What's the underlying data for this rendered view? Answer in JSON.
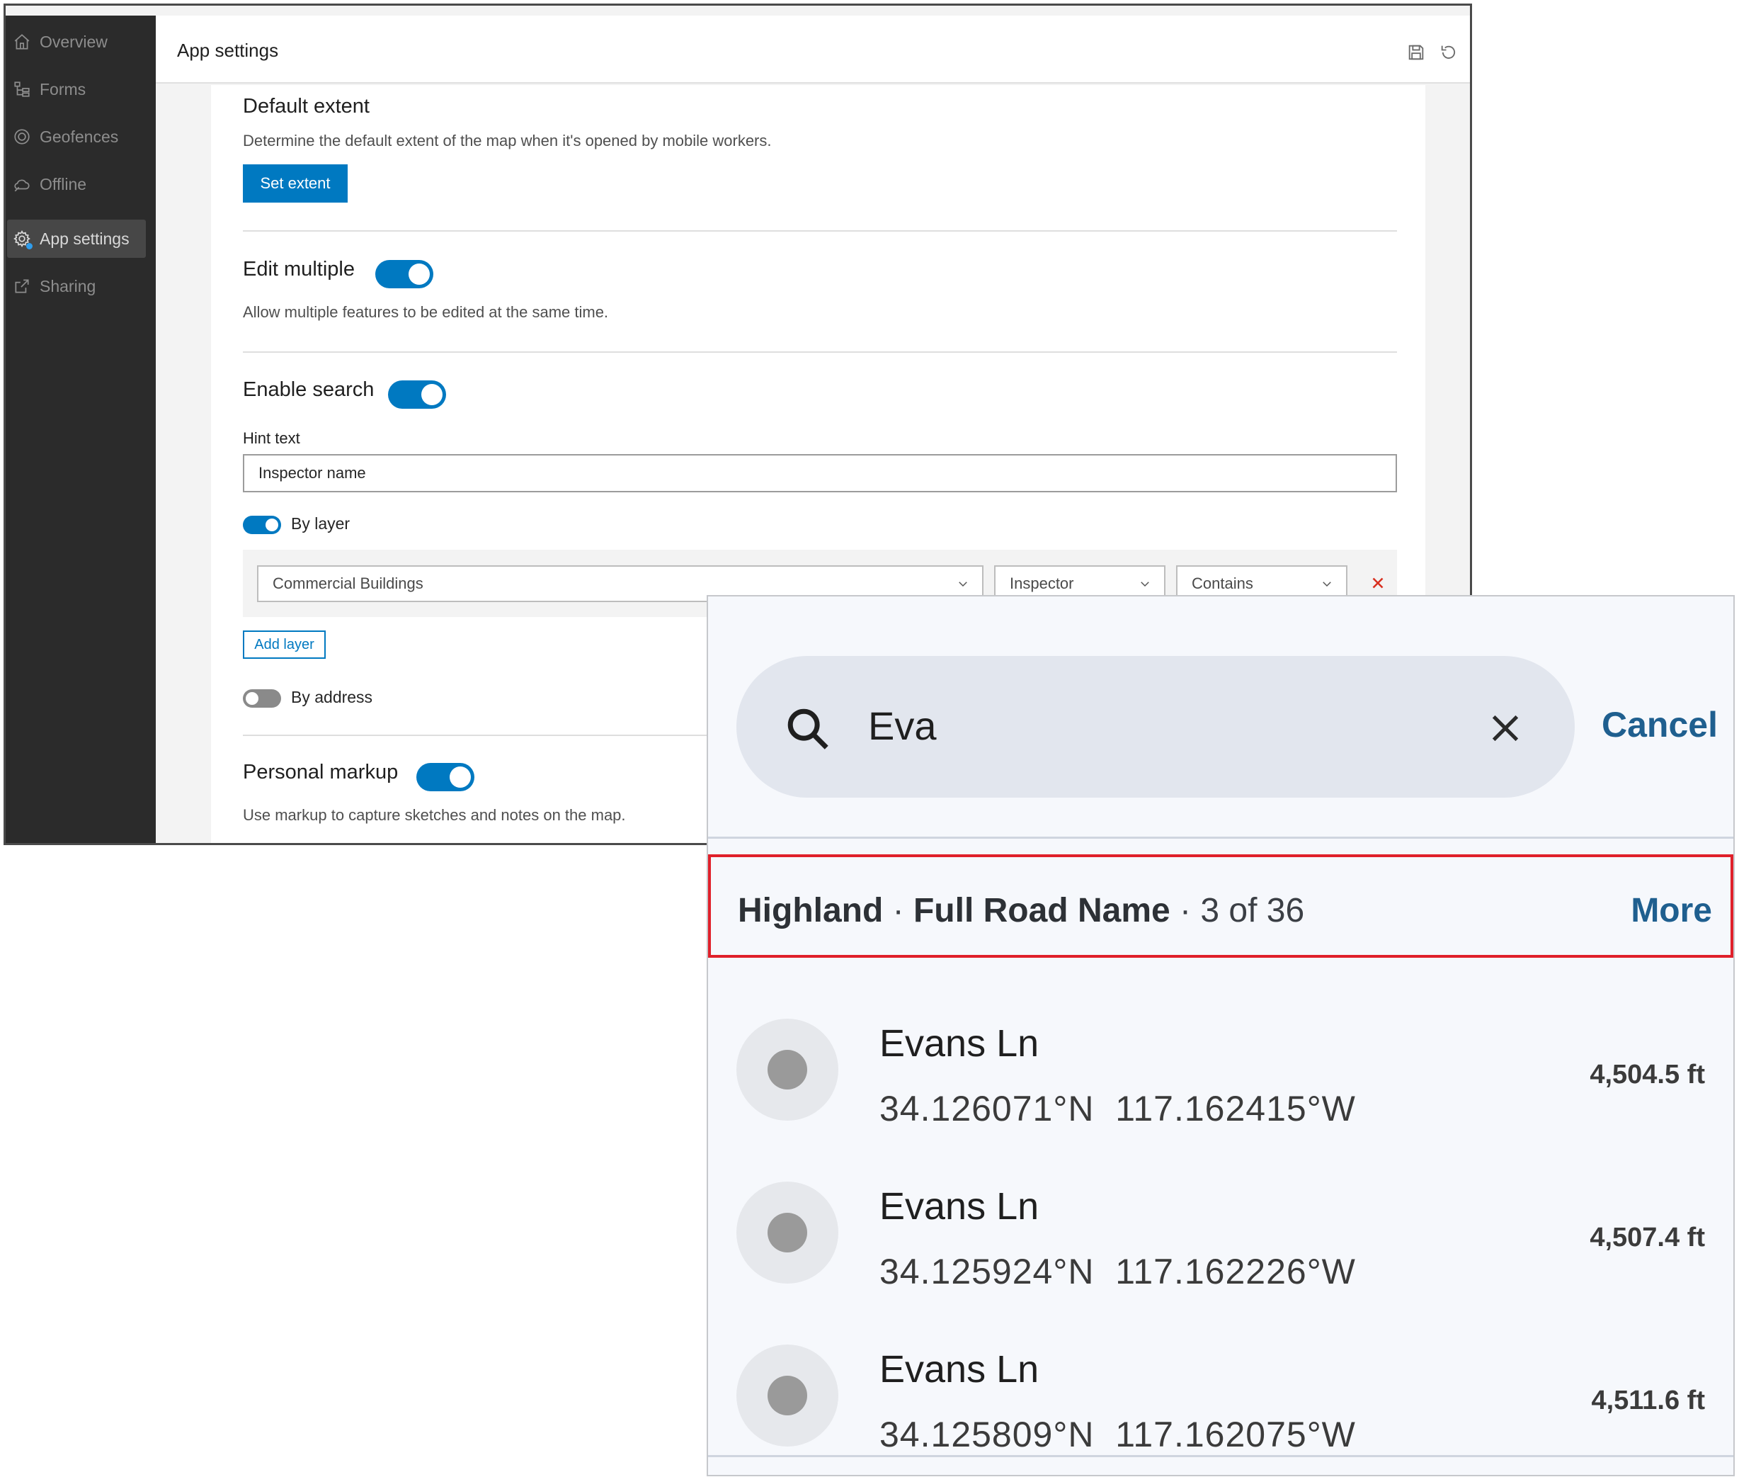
{
  "sidebar": {
    "items": [
      {
        "label": "Overview",
        "icon": "home-icon"
      },
      {
        "label": "Forms",
        "icon": "forms-tree-icon"
      },
      {
        "label": "Geofences",
        "icon": "geofence-target-icon"
      },
      {
        "label": "Offline",
        "icon": "offline-cloud-icon"
      },
      {
        "label": "App settings",
        "icon": "gear-icon",
        "active": true
      },
      {
        "label": "Sharing",
        "icon": "share-icon"
      }
    ]
  },
  "header": {
    "title": "App settings",
    "icons": [
      "save-icon",
      "reset-icon"
    ]
  },
  "settings": {
    "default_extent": {
      "title": "Default extent",
      "description": "Determine the default extent of the map when it's opened by mobile workers.",
      "button": "Set extent"
    },
    "edit_multiple": {
      "title": "Edit multiple",
      "enabled": true,
      "description": "Allow multiple features to be edited at the same time."
    },
    "enable_search": {
      "title": "Enable search",
      "enabled": true,
      "hint_label": "Hint text",
      "hint_value": "Inspector name",
      "by_layer_label": "By layer",
      "by_layer_enabled": true,
      "layer": "Commercial Buildings",
      "field": "Inspector",
      "operator": "Contains",
      "add_layer": "Add layer",
      "by_address_label": "By address",
      "by_address_enabled": false
    },
    "personal_markup": {
      "title": "Personal markup",
      "enabled": true,
      "description": "Use markup to capture sketches and notes on the map."
    }
  },
  "mobile": {
    "search_value": "Eva",
    "cancel": "Cancel",
    "group": {
      "layer": "Highland",
      "sep1": " · ",
      "field": "Full Road Name",
      "sep2": " · ",
      "count": "3 of 36",
      "more": "More"
    },
    "results": [
      {
        "title": "Evans Ln",
        "coords": "34.126071°N  117.162415°W",
        "distance": "4,504.5 ft"
      },
      {
        "title": "Evans Ln",
        "coords": "34.125924°N  117.162226°W",
        "distance": "4,507.4 ft"
      },
      {
        "title": "Evans Ln",
        "coords": "34.125809°N  117.162075°W",
        "distance": "4,511.6 ft"
      }
    ]
  },
  "colors": {
    "accent": "#0079c1",
    "sidebar_bg": "#2b2b2b",
    "highlight_border": "#e0202a",
    "mobile_link": "#1f5f8f"
  }
}
